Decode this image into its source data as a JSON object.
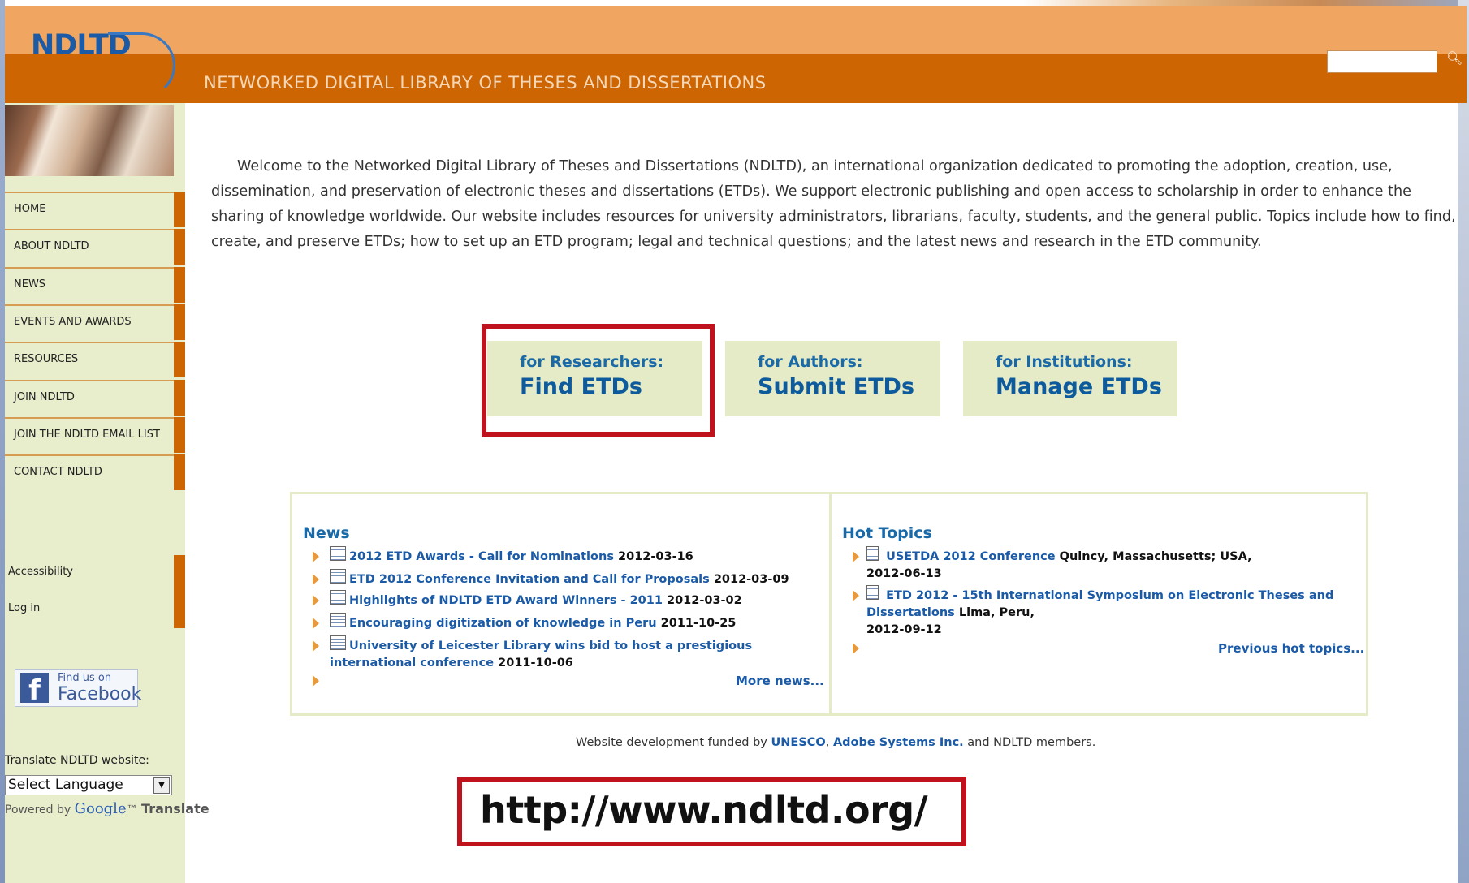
{
  "header": {
    "logo": "NDLTD",
    "site_name": "NETWORKED DIGITAL LIBRARY OF THESES AND DISSERTATIONS",
    "search_value": ""
  },
  "sidebar": {
    "nav": [
      "HOME",
      "ABOUT NDLTD",
      "NEWS",
      "EVENTS AND AWARDS",
      "RESOURCES",
      "JOIN NDLTD",
      "JOIN THE NDLTD EMAIL LIST",
      "CONTACT NDLTD"
    ],
    "secondary": [
      "Accessibility",
      "Log in"
    ],
    "facebook": {
      "find": "Find us on",
      "name": "Facebook",
      "glyph": "f"
    },
    "translate_label": "Translate NDLTD website:",
    "language_select": "Select Language",
    "powered_by": "Powered by",
    "google": "Google",
    "translate": "Translate"
  },
  "welcome_text": "Welcome to the Networked Digital Library of Theses and Dissertations (NDLTD), an international organization dedicated to promoting the adoption, creation, use, dissemination, and preservation of electronic theses and dissertations (ETDs). We support electronic publishing and open access to scholarship in order to enhance the sharing of knowledge worldwide. Our website includes resources for university administrators, librarians, faculty, students, and the general public. Topics include how to find, create, and preserve ETDs; how to set up an ETD program; legal and technical questions; and the latest news and research in the ETD community.",
  "roles": [
    {
      "sub": "for Researchers:",
      "main": "Find ETDs"
    },
    {
      "sub": "for Authors:",
      "main": "Submit ETDs"
    },
    {
      "sub": "for Institutions:",
      "main": "Manage ETDs"
    }
  ],
  "news": {
    "title": "News",
    "items": [
      {
        "link": "2012 ETD Awards - Call for Nominations",
        "date": "2012-03-16"
      },
      {
        "link": "ETD 2012 Conference Invitation and Call for Proposals",
        "date": "2012-03-09"
      },
      {
        "link": "Highlights of NDLTD ETD Award Winners - 2011",
        "date": "2012-03-02"
      },
      {
        "link": "Encouraging digitization of knowledge in Peru",
        "date": "2011-10-25"
      },
      {
        "link": "University of Leicester Library wins bid to host a prestigious",
        "link2": "international conference",
        "date": "2011-10-06"
      }
    ],
    "more": "More news..."
  },
  "hot_topics": {
    "title": "Hot Topics",
    "items": [
      {
        "link": "USETDA 2012 Conference",
        "location": "Quincy, Massachusetts; USA,",
        "date": "2012-06-13"
      },
      {
        "link": "ETD 2012 - 15th International Symposium on Electronic Theses and",
        "link2": "Dissertations",
        "location": "Lima, Peru,",
        "date": "2012-09-12"
      }
    ],
    "more": "Previous hot topics..."
  },
  "funding": {
    "prefix": "Website development funded by",
    "org1": "UNESCO",
    "sep": ",",
    "org2": "Adobe Systems Inc.",
    "suffix": "and NDLTD members."
  },
  "url_caption": "http://www.ndltd.org/"
}
